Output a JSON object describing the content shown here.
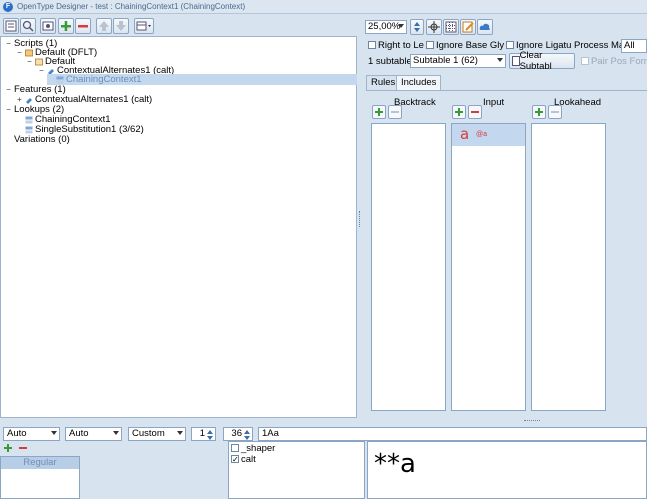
{
  "titlebar": {
    "app_icon": "F",
    "title": "OpenType Designer - test : ChainingContext1 (ChainingContext)"
  },
  "toolbar": {
    "icons": [
      "expand-tree-icon",
      "search-tree-icon",
      "add-icon",
      "remove-icon",
      "move-up-icon",
      "move-down-icon",
      "view-menu-icon"
    ]
  },
  "tree": {
    "rows": [
      {
        "expander": "−",
        "label": "Scripts (1)"
      },
      {
        "expander": "−",
        "label": "Default (DFLT)"
      },
      {
        "expander": "−",
        "label": "Default"
      },
      {
        "expander": "−",
        "label": "ContextualAlternates1 (calt)"
      },
      {
        "expander": "",
        "label": "ChainingContext1"
      },
      {
        "expander": "−",
        "label": "Features (1)"
      },
      {
        "expander": "+",
        "label": "ContextualAlternates1 (calt)"
      },
      {
        "expander": "−",
        "label": "Lookups (2)"
      },
      {
        "expander": "",
        "label": "ChainingContext1"
      },
      {
        "expander": "",
        "label": "SingleSubstitution1 (3/62)"
      },
      {
        "expander": "",
        "label": "Variations (0)"
      }
    ]
  },
  "right": {
    "zoom": "25,00%",
    "flags": {
      "right_to_left": "Right to Le",
      "ignore_base": "Ignore Base Gly",
      "ignore_ligatures": "Ignore Ligatu",
      "process_marks_label": "Process Mar",
      "process_marks_value": "All"
    },
    "subtable_label": "1 subtable",
    "subtable_value": "Subtable 1 (62)",
    "clear_button": "Clear Subtabl",
    "pair_pos": "Pair Pos Form",
    "tabs": [
      "Rules",
      "Includes"
    ],
    "columns": {
      "backtrack": "Backtrack",
      "input": "Input",
      "lookahead": "Lookahead"
    },
    "input_item": {
      "glyph": "a",
      "tag": "@a"
    }
  },
  "bottom": {
    "combo1": "Auto",
    "combo2": "Auto",
    "combo3": "Custom",
    "spin1": "1",
    "spin2": "36",
    "sample": "1Aa",
    "style_item": "Regular",
    "features": [
      {
        "label": "_shaper",
        "checked": false
      },
      {
        "label": "calt",
        "checked": true
      }
    ],
    "preview": "**a"
  },
  "colors": {
    "background": "#d7e3ef",
    "selection": "#c3d7ef",
    "add_green": "#3a9a3a",
    "remove_red": "#d93a3a",
    "glyph_red": "#d93a3a"
  }
}
